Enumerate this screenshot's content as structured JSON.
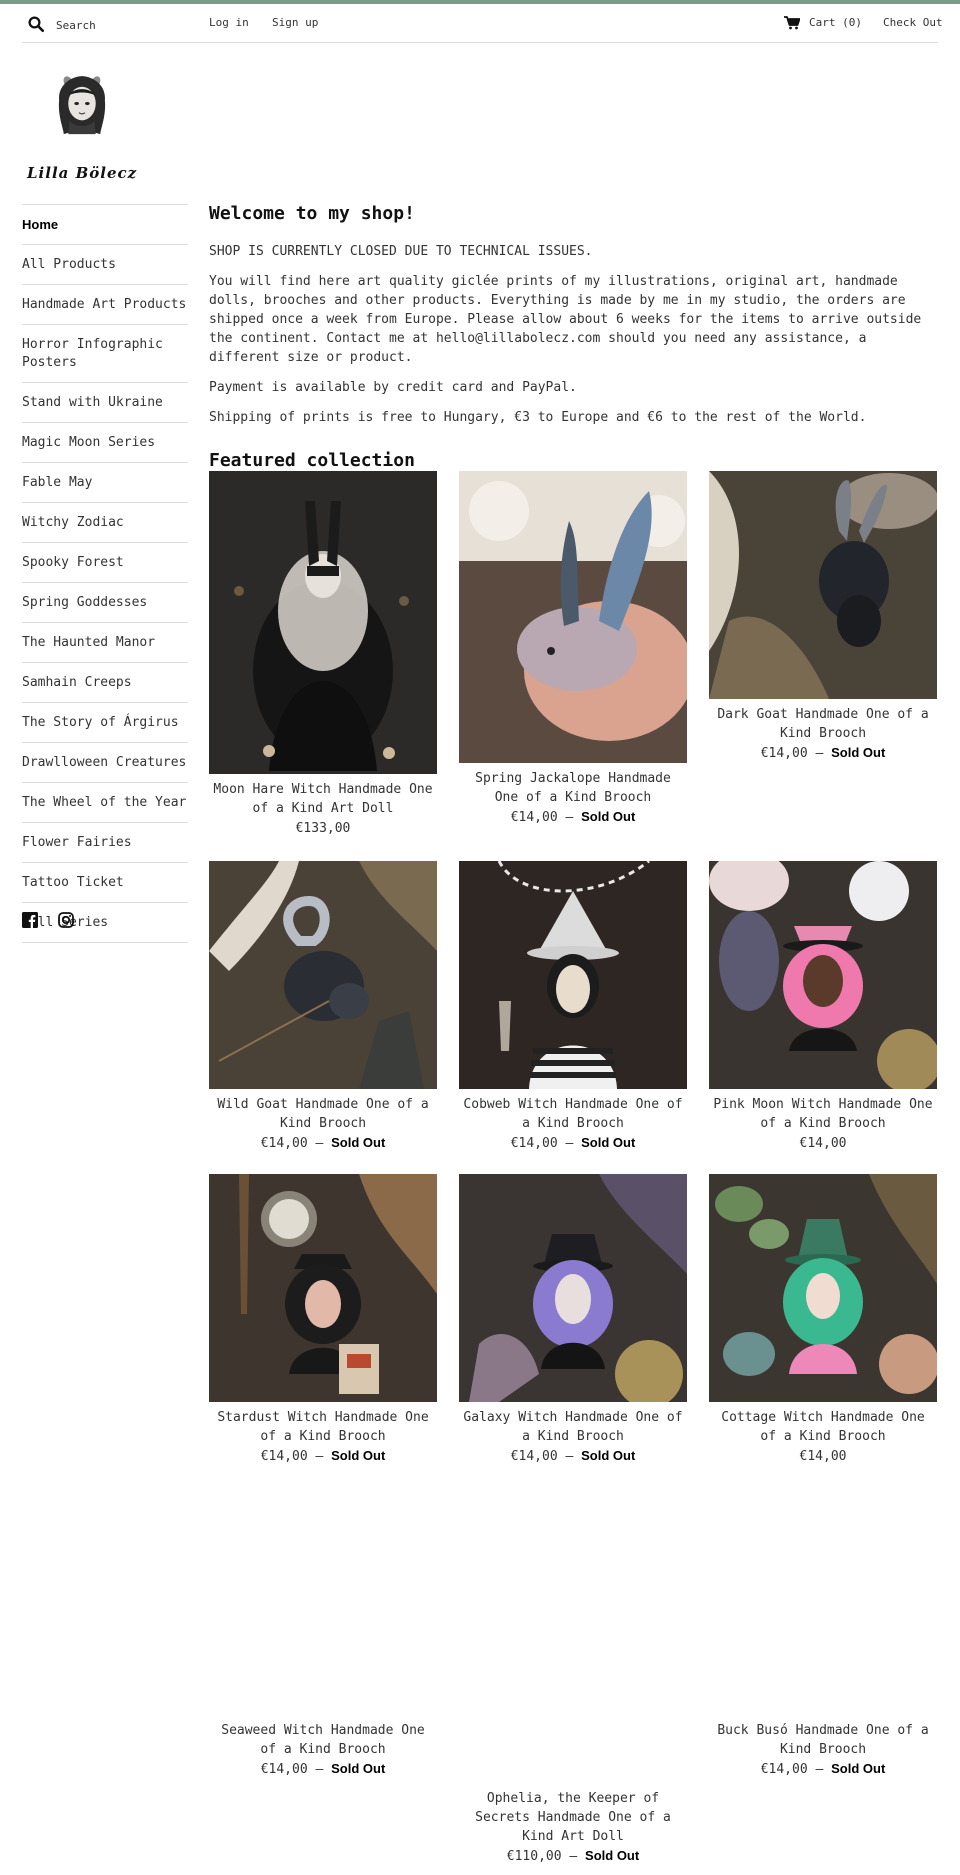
{
  "header": {
    "search_placeholder": "Search",
    "login": "Log in",
    "signup": "Sign up",
    "cart": "Cart (0)",
    "checkout": "Check Out"
  },
  "brand": {
    "name": "Lilla Bölecz"
  },
  "sidebar": {
    "items": [
      {
        "label": "Home"
      },
      {
        "label": "All Products"
      },
      {
        "label": "Handmade Art Products"
      },
      {
        "label": "Horror Infographic Posters"
      },
      {
        "label": "Stand with Ukraine"
      },
      {
        "label": "Magic Moon Series"
      },
      {
        "label": "Fable May"
      },
      {
        "label": "Witchy Zodiac"
      },
      {
        "label": "Spooky Forest"
      },
      {
        "label": "Spring Goddesses"
      },
      {
        "label": "The Haunted Manor"
      },
      {
        "label": "Samhain Creeps"
      },
      {
        "label": "The Story of Árgirus"
      },
      {
        "label": "Drawlloween Creatures"
      },
      {
        "label": "The Wheel of the Year"
      },
      {
        "label": "Flower Fairies"
      },
      {
        "label": "Tattoo Ticket"
      },
      {
        "label": "Full Series"
      }
    ],
    "social": [
      "facebook-icon",
      "instagram-icon"
    ]
  },
  "main": {
    "title": "Welcome to my shop!",
    "notice": "SHOP IS CURRENTLY CLOSED DUE TO TECHNICAL ISSUES.",
    "intro": "You will find here art quality giclée prints of my illustrations, original art, handmade dolls, brooches and other products. Everything is made by me in my studio, the orders are shipped once a week from Europe. Please allow about 6 weeks for the items to arrive outside the continent. Contact me at hello@lillabolecz.com should you need any assistance, a different size or product.",
    "payment": "Payment is available by credit card and PayPal.",
    "shipping": "Shipping of prints is free to Hungary, €3 to Europe and €6 to the rest of the World.",
    "featured_title": "Featured collection"
  },
  "products": [
    {
      "title": "Moon Hare Witch Handmade One of a Kind Art Doll",
      "price": "€133,00",
      "sold_out": ""
    },
    {
      "title": "Spring Jackalope Handmade One of a Kind Brooch",
      "price": "€14,00 —",
      "sold_out": "Sold Out"
    },
    {
      "title": "Dark Goat Handmade One of a Kind Brooch",
      "price": "€14,00 —",
      "sold_out": "Sold Out"
    },
    {
      "title": "Wild Goat Handmade One of a Kind Brooch",
      "price": "€14,00 —",
      "sold_out": "Sold Out"
    },
    {
      "title": "Cobweb Witch Handmade One of a Kind Brooch",
      "price": "€14,00 —",
      "sold_out": "Sold Out"
    },
    {
      "title": "Pink Moon Witch Handmade One of a Kind Brooch",
      "price": "€14,00",
      "sold_out": ""
    },
    {
      "title": "Stardust Witch Handmade One of a Kind Brooch",
      "price": "€14,00 —",
      "sold_out": "Sold Out"
    },
    {
      "title": "Galaxy Witch Handmade One of a Kind Brooch",
      "price": "€14,00 —",
      "sold_out": "Sold Out"
    },
    {
      "title": "Cottage Witch Handmade One of a Kind Brooch",
      "price": "€14,00",
      "sold_out": ""
    },
    {
      "title": "Seaweed Witch Handmade One of a Kind Brooch",
      "price": "€14,00 —",
      "sold_out": "Sold Out"
    },
    {
      "title": "Ophelia, the Keeper of Secrets Handmade One of a Kind Art Doll",
      "price": "€110,00 —",
      "sold_out": "Sold Out"
    },
    {
      "title": "Buck Busó Handmade One of a Kind Brooch",
      "price": "€14,00 —",
      "sold_out": "Sold Out"
    }
  ],
  "colors": {
    "accent_bar": "#7a9b8a",
    "divider": "#dddddd",
    "text": "#333333"
  }
}
